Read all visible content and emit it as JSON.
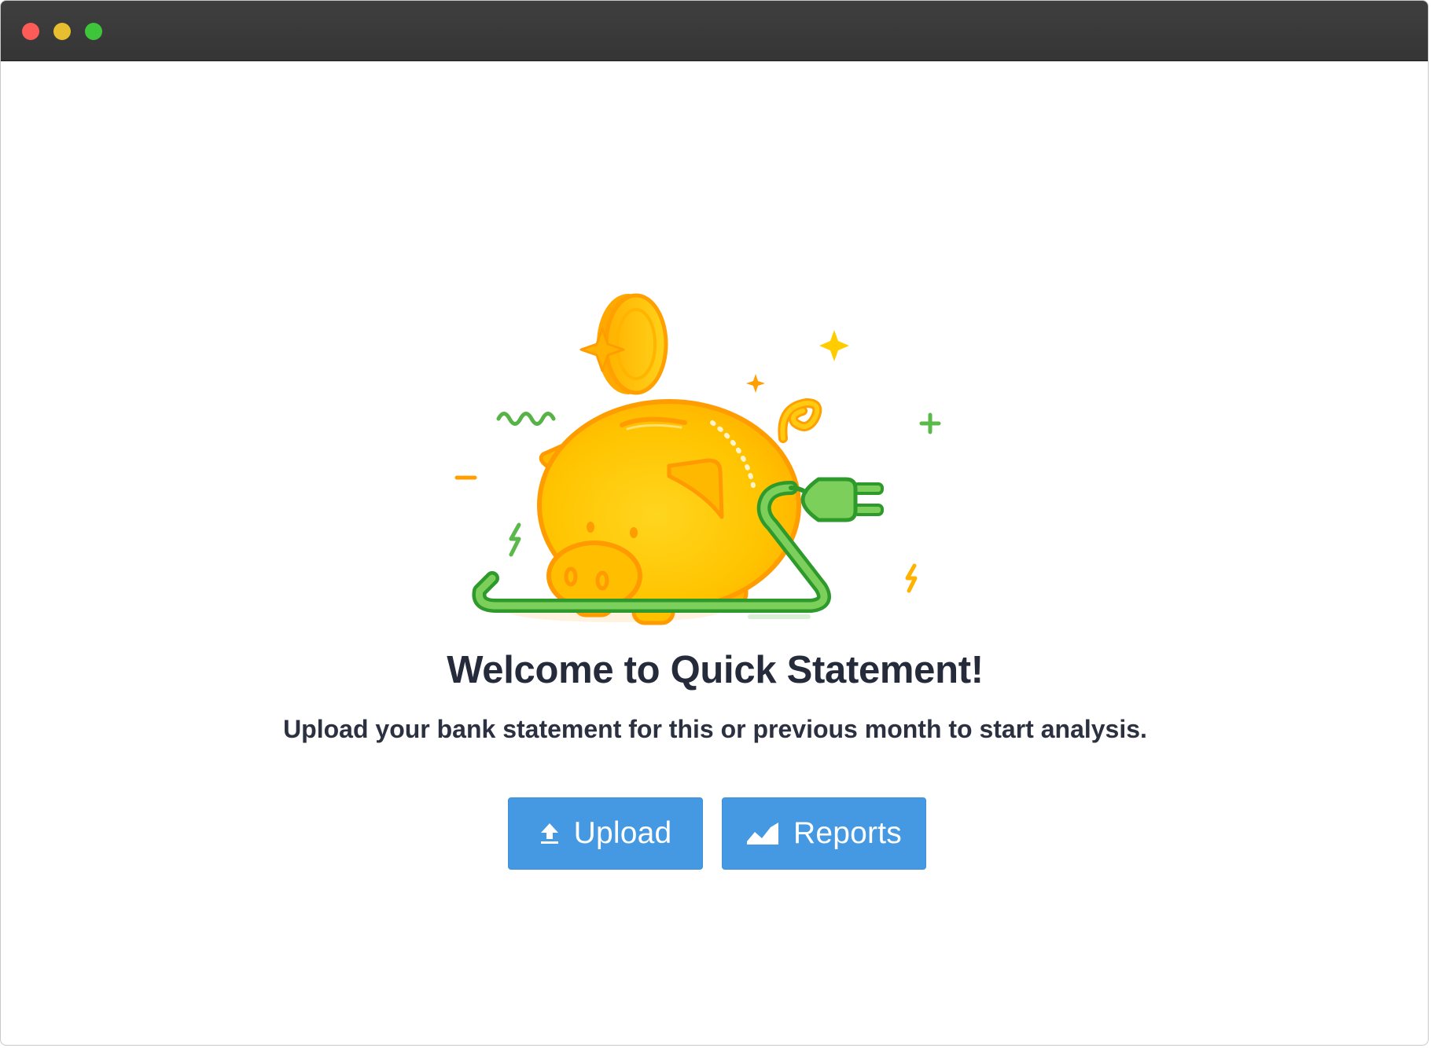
{
  "window": {
    "controls": [
      "close",
      "minimize",
      "zoom"
    ]
  },
  "welcome": {
    "title": "Welcome to Quick Statement!",
    "subtitle": "Upload your bank statement for this or previous month to start analysis."
  },
  "actions": {
    "upload_label": "Upload",
    "upload_icon": "upload-icon",
    "reports_label": "Reports",
    "reports_icon": "area-chart-icon"
  },
  "colors": {
    "titlebar": "#3a3a3a",
    "button": "#4499e2",
    "text": "#252b3a",
    "coin": "#ffc107",
    "cord": "#52b043"
  },
  "illustration": "piggy-bank-with-plug"
}
